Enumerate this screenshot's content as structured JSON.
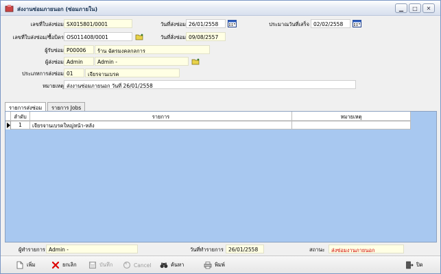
{
  "window": {
    "title": "ส่งงานซ่อมภายนอก (ซ่อมภายใน)"
  },
  "form": {
    "doc_no": {
      "label": "เลขที่ใบส่งซ่อม",
      "value": "SX015801/0001"
    },
    "send_date": {
      "label": "วันที่ส่งซ่อม",
      "value": "26/01/2558"
    },
    "est_finish": {
      "label": "ประมาณวันที่เสร็จ",
      "value": "02/02/2558"
    },
    "ref_doc": {
      "label": "เลขที่ใบส่งซ่อม/ซื้อบิคร",
      "value": "OS011408/0001"
    },
    "order_date": {
      "label": "วันที่สั่งซ่อม",
      "value": "09/08/2557"
    },
    "receiver": {
      "label": "ผู้รับซ่อม",
      "code": "P00006",
      "name": "ร้าน ฉัตรมงคลกลการ"
    },
    "sender": {
      "label": "ผู้ส่งซ่อม",
      "code": "Admin",
      "name": "Admin -"
    },
    "repair_type": {
      "label": "ประเภทการส่งซ่อม",
      "code": "01",
      "name": "เจียรจานเบรค"
    },
    "remark": {
      "label": "หมายเหตุ",
      "value": "ส่งงานซ่อมภายนอก วันที่ 26/01/2558"
    }
  },
  "tabs": [
    {
      "label": "รายการส่งซ่อม"
    },
    {
      "label": "รายการ Jobs"
    }
  ],
  "grid": {
    "columns": [
      "ลำดับ",
      "รายการ",
      "หมายเหตุ"
    ],
    "rows": [
      {
        "no": "1",
        "item": "เจียรจานเบรคใหญ่หน้า-หลัง",
        "note": ""
      }
    ]
  },
  "footer": {
    "creator_label": "ผู้ทำรายการ",
    "creator_value": "Admin -",
    "created_date_label": "วันที่ทำรายการ",
    "created_date_value": "26/01/2558",
    "status_label": "สถานะ",
    "status_value": "ส่งซ่อมงานภายนอก"
  },
  "toolbar": {
    "add": "เพิ่ม",
    "cancel_doc": "ยกเลิก",
    "save": "บันทึก",
    "cancel": "Cancel",
    "search": "ค้นหา",
    "print": "พิมพ์",
    "close": "ปิด"
  },
  "colors": {
    "accent": "#a8c8f0",
    "field_bg": "#ffffe4",
    "status": "#d00000"
  }
}
